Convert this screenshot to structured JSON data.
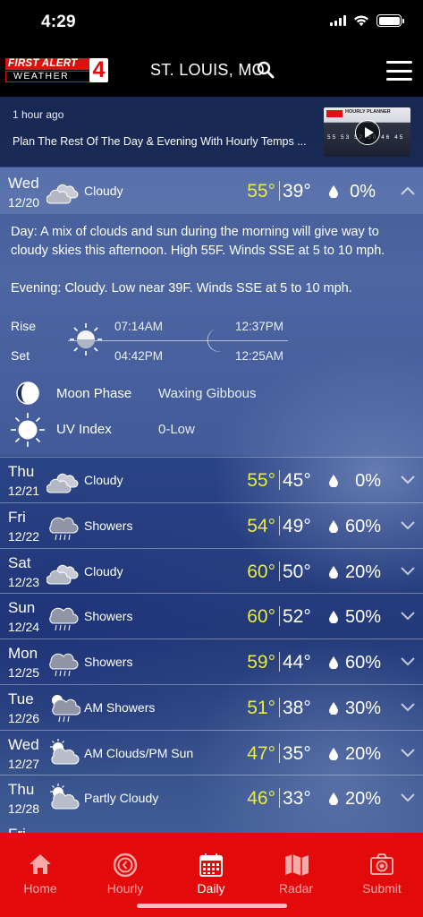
{
  "status": {
    "time": "4:29"
  },
  "header": {
    "brand_top": "FIRST ALERT",
    "brand_bottom": "WEATHER",
    "brand_number": "4",
    "city": "ST. LOUIS, MO"
  },
  "news": {
    "time": "1 hour ago",
    "title": "Plan The Rest Of The Day & Evening With Hourly Temps ...",
    "thumb_title": "HOURLY PLANNER",
    "thumb_temps": "55 53 52 50 46 45"
  },
  "today": {
    "day": "Wed",
    "date": "12/20",
    "condition": "Cloudy",
    "icon": "cloudy-icon",
    "high": "55°",
    "low": "39°",
    "precip": "0%",
    "day_label": "Day",
    "day_text": ": A mix of clouds and sun during the morning will give way to cloudy skies this afternoon. High 55F. Winds SSE at 5 to 10 mph.",
    "evening_label": "Evening",
    "evening_text": ": Cloudy. Low near 39F. Winds SSE at 5 to 10 mph.",
    "rise_label": "Rise",
    "set_label": "Set",
    "sunrise": "07:14AM",
    "sunset": "04:42PM",
    "moonrise": "12:37PM",
    "moonset": "12:25AM",
    "moon_phase_label": "Moon Phase",
    "moon_phase": "Waxing Gibbous",
    "uv_label": "UV Index",
    "uv": "0-Low"
  },
  "forecast": [
    {
      "day": "Thu",
      "date": "12/21",
      "condition": "Cloudy",
      "icon": "cloudy-icon",
      "high": "55°",
      "low": "45°",
      "precip": "0%"
    },
    {
      "day": "Fri",
      "date": "12/22",
      "condition": "Showers",
      "icon": "showers-icon",
      "high": "54°",
      "low": "49°",
      "precip": "60%"
    },
    {
      "day": "Sat",
      "date": "12/23",
      "condition": "Cloudy",
      "icon": "cloudy-icon",
      "high": "60°",
      "low": "50°",
      "precip": "20%"
    },
    {
      "day": "Sun",
      "date": "12/24",
      "condition": "Showers",
      "icon": "showers-icon",
      "high": "60°",
      "low": "52°",
      "precip": "50%"
    },
    {
      "day": "Mon",
      "date": "12/25",
      "condition": "Showers",
      "icon": "showers-icon",
      "high": "59°",
      "low": "44°",
      "precip": "60%"
    },
    {
      "day": "Tue",
      "date": "12/26",
      "condition": "AM Showers",
      "icon": "am-showers-icon",
      "high": "51°",
      "low": "38°",
      "precip": "30%"
    },
    {
      "day": "Wed",
      "date": "12/27",
      "condition": "AM Clouds/PM Sun",
      "icon": "partly-cloudy-icon",
      "high": "47°",
      "low": "35°",
      "precip": "20%"
    },
    {
      "day": "Thu",
      "date": "12/28",
      "condition": "Partly Cloudy",
      "icon": "partly-cloudy-icon",
      "high": "46°",
      "low": "33°",
      "precip": "20%"
    }
  ],
  "partial_next_day": "Fri",
  "tabs": [
    {
      "label": "Home",
      "icon": "home-icon",
      "active": false
    },
    {
      "label": "Hourly",
      "icon": "clock-icon",
      "active": false
    },
    {
      "label": "Daily",
      "icon": "calendar-icon",
      "active": true
    },
    {
      "label": "Radar",
      "icon": "map-icon",
      "active": false
    },
    {
      "label": "Submit",
      "icon": "camera-icon",
      "active": false
    }
  ],
  "colors": {
    "high_temp": "#e8ec3a",
    "tabbar": "#e20a0a",
    "header": "#000000"
  }
}
